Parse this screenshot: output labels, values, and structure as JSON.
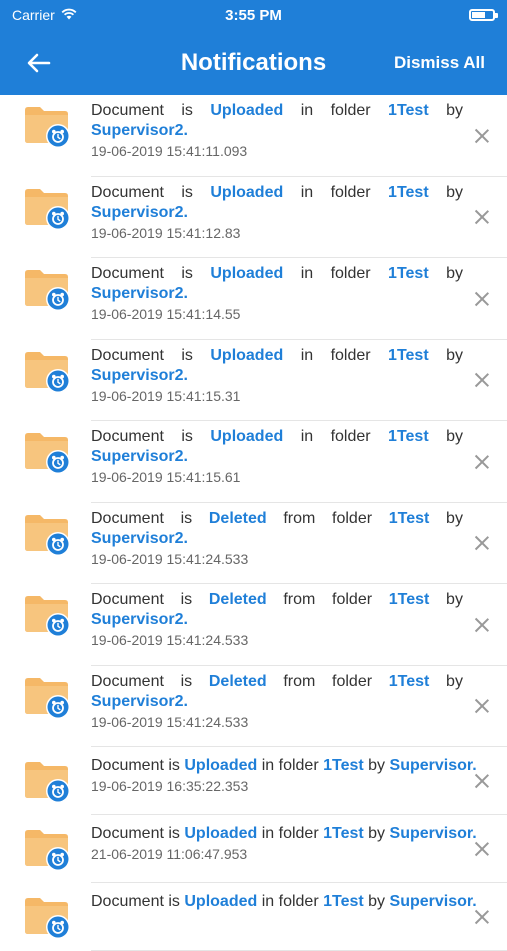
{
  "status_bar": {
    "carrier": "Carrier",
    "time": "3:55 PM"
  },
  "header": {
    "title": "Notifications",
    "dismiss_all": "Dismiss All"
  },
  "colors": {
    "primary": "#1f7fd8",
    "folder": "#f5b867",
    "badge": "#1f7fd8"
  },
  "notifications": [
    {
      "w1": "Document",
      "w2": "is",
      "action": "Uploaded",
      "prep": "in",
      "w4": "folder",
      "folder": "1Test",
      "by": "by",
      "user": "Supervisor2",
      "punct": ".",
      "timestamp": "19-06-2019 15:41:11.093"
    },
    {
      "w1": "Document",
      "w2": "is",
      "action": "Uploaded",
      "prep": "in",
      "w4": "folder",
      "folder": "1Test",
      "by": "by",
      "user": "Supervisor2",
      "punct": ".",
      "timestamp": "19-06-2019 15:41:12.83"
    },
    {
      "w1": "Document",
      "w2": "is",
      "action": "Uploaded",
      "prep": "in",
      "w4": "folder",
      "folder": "1Test",
      "by": "by",
      "user": "Supervisor2",
      "punct": ".",
      "timestamp": "19-06-2019 15:41:14.55"
    },
    {
      "w1": "Document",
      "w2": "is",
      "action": "Uploaded",
      "prep": "in",
      "w4": "folder",
      "folder": "1Test",
      "by": "by",
      "user": "Supervisor2",
      "punct": ".",
      "timestamp": "19-06-2019 15:41:15.31"
    },
    {
      "w1": "Document",
      "w2": "is",
      "action": "Uploaded",
      "prep": "in",
      "w4": "folder",
      "folder": "1Test",
      "by": "by",
      "user": "Supervisor2",
      "punct": ".",
      "timestamp": "19-06-2019 15:41:15.61"
    },
    {
      "w1": "Document",
      "w2": "is",
      "action": "Deleted",
      "prep": "from",
      "w4": "folder",
      "folder": "1Test",
      "by": "by",
      "user": "Supervisor2",
      "punct": ".",
      "timestamp": "19-06-2019 15:41:24.533"
    },
    {
      "w1": "Document",
      "w2": "is",
      "action": "Deleted",
      "prep": "from",
      "w4": "folder",
      "folder": "1Test",
      "by": "by",
      "user": "Supervisor2",
      "punct": ".",
      "timestamp": "19-06-2019 15:41:24.533"
    },
    {
      "w1": "Document",
      "w2": "is",
      "action": "Deleted",
      "prep": "from",
      "w4": "folder",
      "folder": "1Test",
      "by": "by",
      "user": "Supervisor2",
      "punct": ".",
      "timestamp": "19-06-2019 15:41:24.533"
    },
    {
      "w1": "Document is",
      "action": "Uploaded",
      "prep": "in folder",
      "folder": "1Test",
      "by": "by",
      "user": "Supervisor",
      "punct": ".",
      "timestamp": "19-06-2019 16:35:22.353",
      "compact": true
    },
    {
      "w1": "Document is",
      "action": "Uploaded",
      "prep": "in folder",
      "folder": "1Test",
      "by": "by",
      "user": "Supervisor",
      "punct": ".",
      "timestamp": "21-06-2019 11:06:47.953",
      "compact": true
    },
    {
      "w1": "Document is",
      "action": "Uploaded",
      "prep": "in folder",
      "folder": "1Test",
      "by": "by",
      "user": "Supervisor",
      "punct": ".",
      "timestamp": "",
      "compact": true
    }
  ]
}
